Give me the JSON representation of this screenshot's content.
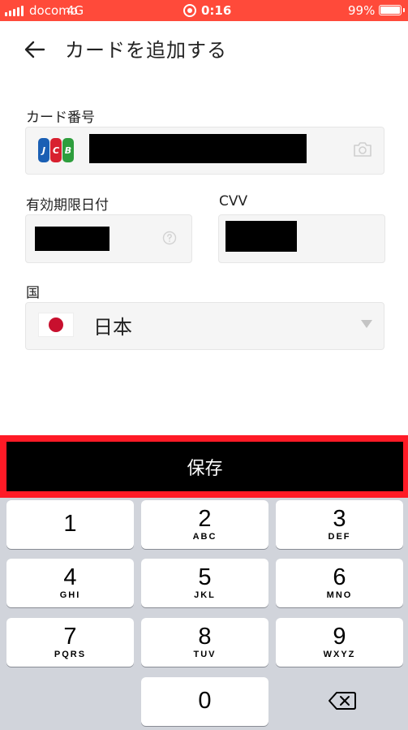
{
  "status_bar": {
    "carrier": "docomo",
    "network": "4G",
    "time": "0:16",
    "battery": "99%",
    "color": "#ff4a3a"
  },
  "header": {
    "title": "カードを追加する",
    "back_icon": "back-arrow-icon"
  },
  "form": {
    "card_number": {
      "label": "カード番号",
      "brand_letters": [
        "J",
        "C",
        "B"
      ],
      "brand_colors": [
        "#1a5fb4",
        "#d8202f",
        "#2e9e3d"
      ],
      "camera_icon": "camera-icon"
    },
    "expiry": {
      "label": "有効期限日付",
      "help_icon": "help-icon"
    },
    "cvv": {
      "label": "CVV"
    },
    "country": {
      "label": "国",
      "value": "日本",
      "flag_icon": "japan-flag-icon",
      "dropdown_icon": "dropdown-triangle-icon"
    }
  },
  "save_button": {
    "label": "保存",
    "highlight_color": "#ff1a26"
  },
  "keypad": {
    "keys": [
      {
        "num": "1",
        "letters": ""
      },
      {
        "num": "2",
        "letters": "ABC"
      },
      {
        "num": "3",
        "letters": "DEF"
      },
      {
        "num": "4",
        "letters": "GHI"
      },
      {
        "num": "5",
        "letters": "JKL"
      },
      {
        "num": "6",
        "letters": "MNO"
      },
      {
        "num": "7",
        "letters": "PQRS"
      },
      {
        "num": "8",
        "letters": "TUV"
      },
      {
        "num": "9",
        "letters": "WXYZ"
      },
      {
        "num": "0",
        "letters": ""
      }
    ],
    "delete_icon": "backspace-icon"
  }
}
